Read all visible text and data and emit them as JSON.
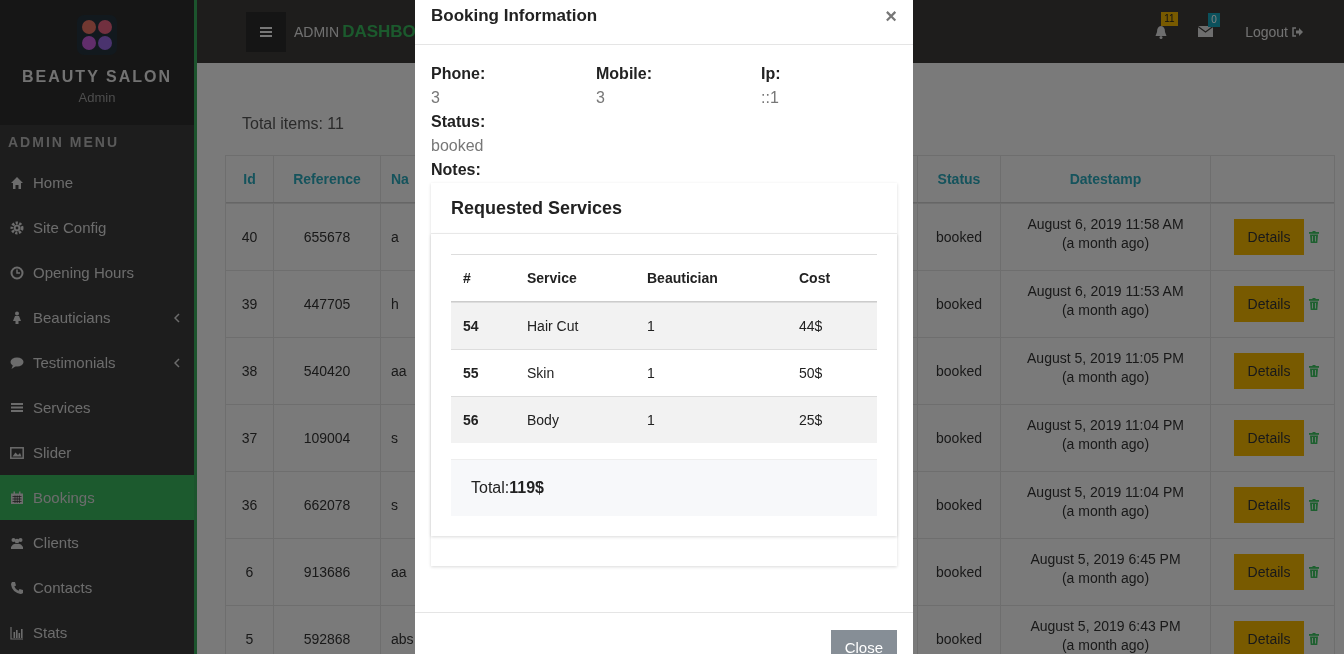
{
  "sidebar": {
    "brand": "BEAUTY SALON",
    "subtitle": "Admin",
    "menu_heading": "ADMIN MENU",
    "items": [
      {
        "label": "Home",
        "selected": false,
        "expandable": false
      },
      {
        "label": "Site Config",
        "selected": false,
        "expandable": false
      },
      {
        "label": "Opening Hours",
        "selected": false,
        "expandable": false
      },
      {
        "label": "Beauticians",
        "selected": false,
        "expandable": true
      },
      {
        "label": "Testimonials",
        "selected": false,
        "expandable": true
      },
      {
        "label": "Services",
        "selected": false,
        "expandable": false
      },
      {
        "label": "Slider",
        "selected": false,
        "expandable": false
      },
      {
        "label": "Bookings",
        "selected": true,
        "expandable": false
      },
      {
        "label": "Clients",
        "selected": false,
        "expandable": false
      },
      {
        "label": "Contacts",
        "selected": false,
        "expandable": false
      },
      {
        "label": "Stats",
        "selected": false,
        "expandable": false
      }
    ]
  },
  "topbar": {
    "title_prefix": "ADMIN",
    "title_main": "DASHBO",
    "notifications": "11",
    "messages": "0",
    "logout": "Logout"
  },
  "content": {
    "total": "Total items: 11",
    "columns": [
      "Id",
      "Reference",
      "Na",
      "Status",
      "Datestamp"
    ],
    "rows": [
      {
        "id": "40",
        "reference": "655678",
        "name": "a",
        "status": "booked",
        "date": "August 6, 2019 11:58 AM",
        "ago": "(a month ago)",
        "action": "Details"
      },
      {
        "id": "39",
        "reference": "447705",
        "name": "h",
        "status": "booked",
        "date": "August 6, 2019 11:53 AM",
        "ago": "(a month ago)",
        "action": "Details"
      },
      {
        "id": "38",
        "reference": "540420",
        "name": "aa",
        "status": "booked",
        "date": "August 5, 2019 11:05 PM",
        "ago": "(a month ago)",
        "action": "Details"
      },
      {
        "id": "37",
        "reference": "109004",
        "name": "s",
        "status": "booked",
        "date": "August 5, 2019 11:04 PM",
        "ago": "(a month ago)",
        "action": "Details"
      },
      {
        "id": "36",
        "reference": "662078",
        "name": "s",
        "status": "booked",
        "date": "August 5, 2019 11:04 PM",
        "ago": "(a month ago)",
        "action": "Details"
      },
      {
        "id": "6",
        "reference": "913686",
        "name": "aa",
        "status": "booked",
        "date": "August 5, 2019 6:45 PM",
        "ago": "(a month ago)",
        "action": "Details"
      },
      {
        "id": "5",
        "reference": "592868",
        "name": "abs",
        "status": "booked",
        "date": "August 5, 2019 6:43 PM",
        "ago": "(a month ago)",
        "action": "Details"
      }
    ]
  },
  "modal": {
    "title": "Booking Information",
    "close_glyph": "×",
    "fields": [
      {
        "label": "Phone:",
        "value": "3"
      },
      {
        "label": "Mobile:",
        "value": "3"
      },
      {
        "label": "Ip:",
        "value": "::1"
      }
    ],
    "status_label": "Status:",
    "status_value": "booked",
    "notes_label": "Notes:",
    "services_title": "Requested Services",
    "services_columns": [
      "#",
      "Service",
      "Beautician",
      "Cost"
    ],
    "services": [
      {
        "num": "54",
        "service": "Hair Cut",
        "beautician": "1",
        "cost": "44$"
      },
      {
        "num": "55",
        "service": "Skin",
        "beautician": "1",
        "cost": "50$"
      },
      {
        "num": "56",
        "service": "Body",
        "beautician": "1",
        "cost": "25$"
      }
    ],
    "total": "Total:**119$**",
    "close_button": "Close"
  }
}
